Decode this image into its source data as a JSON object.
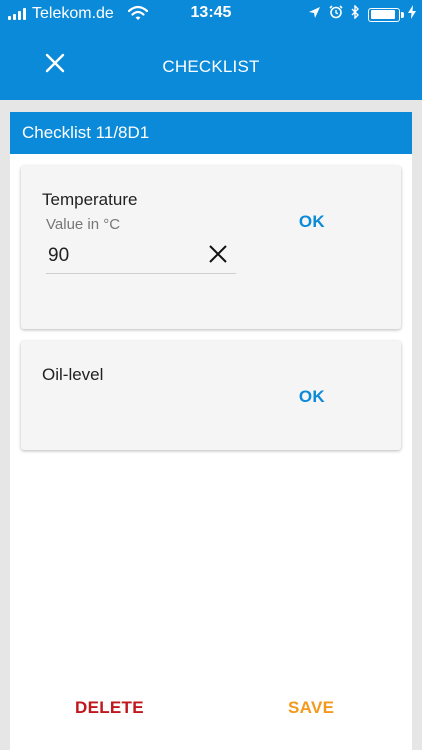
{
  "status_bar": {
    "carrier": "Telekom.de",
    "time": "13:45",
    "battery_level": 0.85
  },
  "app_bar": {
    "title": "CHECKLIST",
    "close_icon": "close-icon"
  },
  "checklist": {
    "header": "Checklist 11/8D1",
    "items": [
      {
        "title": "Temperature",
        "field_label": "Value in °C",
        "field_value": "90",
        "action_label": "OK"
      },
      {
        "title": "Oil-level",
        "action_label": "OK"
      }
    ]
  },
  "actions": {
    "delete_label": "DELETE",
    "save_label": "SAVE"
  },
  "colors": {
    "primary": "#0a8ad8",
    "delete": "#c0171d",
    "save": "#f39a1e"
  }
}
